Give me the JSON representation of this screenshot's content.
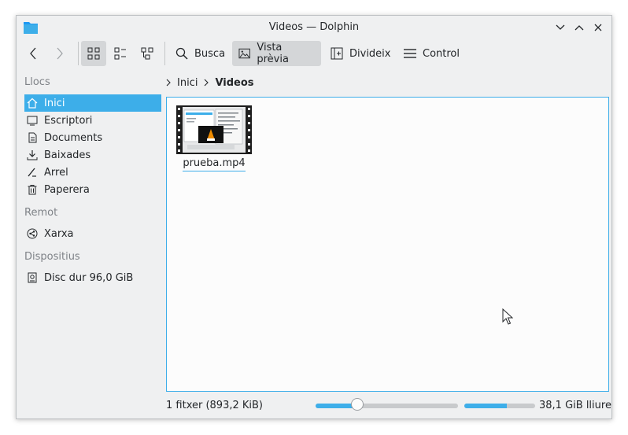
{
  "window": {
    "title": "Videos — Dolphin"
  },
  "toolbar": {
    "search_label": "Busca",
    "preview_label": "Vista prèvia",
    "split_label": "Divideix",
    "control_label": "Control"
  },
  "sidebar": {
    "sections": [
      {
        "header": "Llocs",
        "items": [
          {
            "label": "Inici",
            "icon": "home-icon",
            "selected": true
          },
          {
            "label": "Escriptori",
            "icon": "desktop-icon"
          },
          {
            "label": "Documents",
            "icon": "documents-icon"
          },
          {
            "label": "Baixades",
            "icon": "downloads-icon"
          },
          {
            "label": "Arrel",
            "icon": "root-icon"
          },
          {
            "label": "Paperera",
            "icon": "trash-icon"
          }
        ]
      },
      {
        "header": "Remot",
        "items": [
          {
            "label": "Xarxa",
            "icon": "network-icon"
          }
        ]
      },
      {
        "header": "Dispositius",
        "items": [
          {
            "label": "Disc dur 96,0 GiB",
            "icon": "harddisk-icon"
          }
        ]
      }
    ]
  },
  "breadcrumb": {
    "items": [
      "Inici",
      "Videos"
    ]
  },
  "files": [
    {
      "name": "prueba.mp4"
    }
  ],
  "status": {
    "text": "1 fitxer (893,2 KiB)",
    "zoom_fraction": 0.27,
    "free_space": "38,1 GiB lliure",
    "used_fraction": 0.6
  },
  "colors": {
    "accent": "#3daee9"
  }
}
